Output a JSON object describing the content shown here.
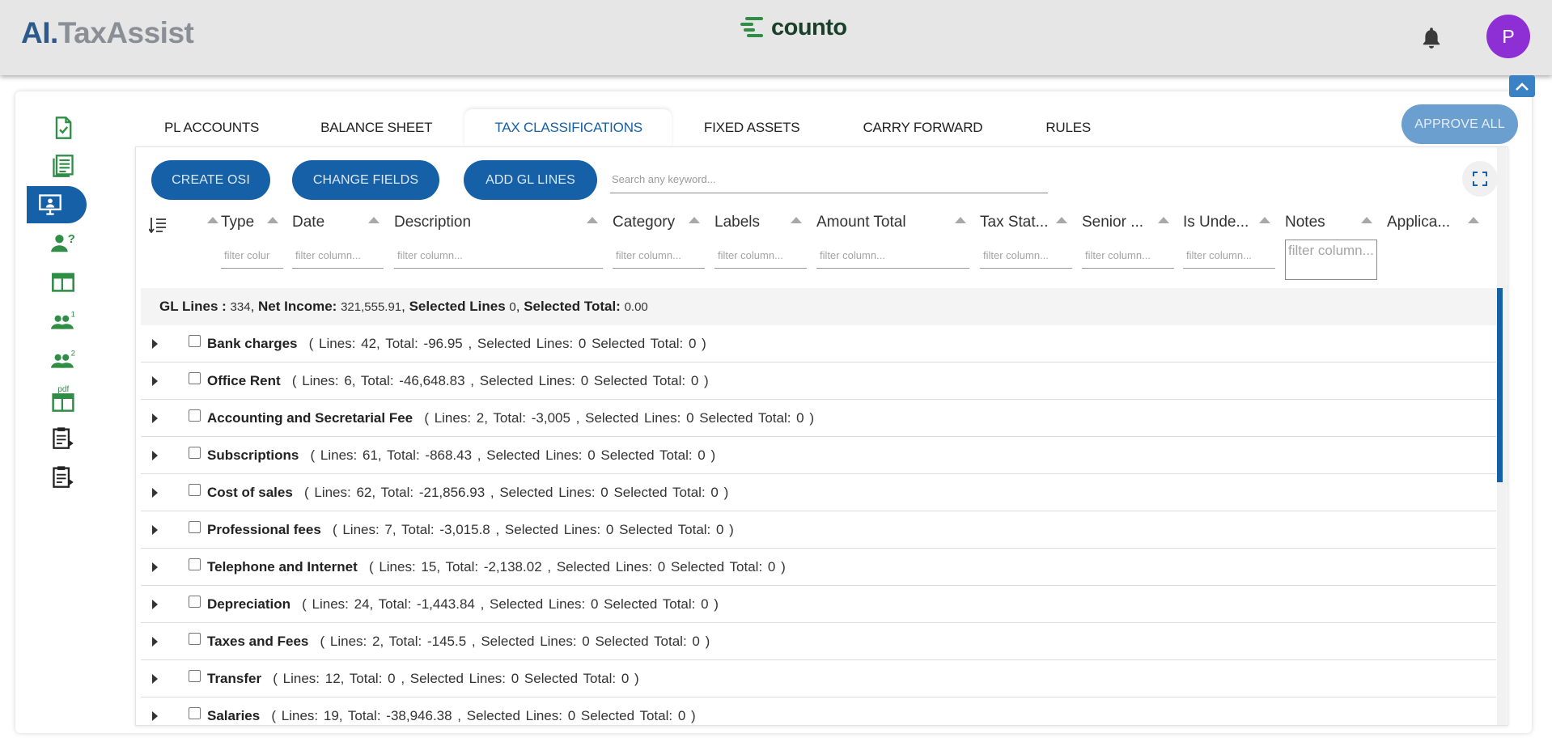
{
  "brand": {
    "part1": "AI.",
    "part2": "TaxAssist"
  },
  "logo_text": "counto",
  "avatar_initial": "P",
  "tabs": [
    {
      "label": "PL ACCOUNTS",
      "active": false
    },
    {
      "label": "BALANCE SHEET",
      "active": false
    },
    {
      "label": "TAX CLASSIFICATIONS",
      "active": true
    },
    {
      "label": "FIXED ASSETS",
      "active": false
    },
    {
      "label": "CARRY FORWARD",
      "active": false
    },
    {
      "label": "RULES",
      "active": false
    }
  ],
  "approve_all": "APPROVE ALL",
  "toolbar": {
    "create_osi": "CREATE OSI",
    "change_fields": "CHANGE FIELDS",
    "add_gl_lines": "ADD GL LINES",
    "search_placeholder": "Search any keyword..."
  },
  "columns": [
    {
      "label": "Type",
      "filter_placeholder": "filter colur"
    },
    {
      "label": "Date",
      "filter_placeholder": "filter column..."
    },
    {
      "label": "Description",
      "filter_placeholder": "filter column..."
    },
    {
      "label": "Category",
      "filter_placeholder": "filter column..."
    },
    {
      "label": "Labels",
      "filter_placeholder": "filter column..."
    },
    {
      "label": "Amount Total",
      "filter_placeholder": "filter column..."
    },
    {
      "label": "Tax Stat...",
      "filter_placeholder": "filter column..."
    },
    {
      "label": "Senior ...",
      "filter_placeholder": "filter column..."
    },
    {
      "label": "Is Unde...",
      "filter_placeholder": "filter column..."
    },
    {
      "label": "Notes",
      "filter_placeholder": "filter column..."
    },
    {
      "label": "Applica..."
    }
  ],
  "summary": {
    "gl_lines_label": "GL Lines :",
    "gl_lines": "334",
    "net_income_label": "Net Income:",
    "net_income": "321,555.91",
    "selected_lines_label": "Selected Lines",
    "selected_lines": "0",
    "selected_total_label": "Selected Total:",
    "selected_total": "0.00"
  },
  "groups": [
    {
      "name": "Bank charges",
      "details": "(   Lines: 42,    Total:    -96.95 ,    Selected Lines: 0    Selected Total: 0 )"
    },
    {
      "name": "Office Rent",
      "details": "(   Lines: 6,    Total:    -46,648.83 ,    Selected Lines: 0    Selected Total: 0 )"
    },
    {
      "name": "Accounting and Secretarial Fee",
      "details": "(   Lines: 2,    Total:    -3,005 ,    Selected Lines: 0    Selected Total: 0 )"
    },
    {
      "name": "Subscriptions",
      "details": "(   Lines: 61,    Total:    -868.43 ,    Selected Lines: 0    Selected Total: 0 )"
    },
    {
      "name": "Cost of sales",
      "details": "(   Lines: 62,    Total:    -21,856.93 ,    Selected Lines: 0    Selected Total: 0 )"
    },
    {
      "name": "Professional fees",
      "details": "(   Lines: 7,    Total:    -3,015.8 ,    Selected Lines: 0    Selected Total: 0 )"
    },
    {
      "name": "Telephone and Internet",
      "details": "(   Lines: 15,    Total:    -2,138.02 ,    Selected Lines: 0    Selected Total: 0 )"
    },
    {
      "name": "Depreciation",
      "details": "(   Lines: 24,    Total:    -1,443.84 ,    Selected Lines: 0    Selected Total: 0 )"
    },
    {
      "name": "Taxes and Fees",
      "details": "(   Lines: 2,    Total:    -145.5 ,    Selected Lines: 0    Selected Total: 0 )"
    },
    {
      "name": "Transfer",
      "details": "(   Lines: 12,    Total:    0 ,    Selected Lines: 0    Selected Total: 0 )"
    },
    {
      "name": "Salaries",
      "details": "(   Lines: 19,    Total:    -38,946.38 ,    Selected Lines: 0    Selected Total: 0 )"
    }
  ],
  "sidebar": {
    "icons": [
      "document-check-icon",
      "list-document-icon",
      "monitor-user-icon",
      "user-question-icon",
      "table-window-icon",
      "users-one-icon",
      "users-two-icon",
      "pdf-table-icon",
      "clipboard-arrow-icon",
      "clipboard-arrow-icon-2"
    ],
    "active_index": 2,
    "badges": {
      "users_one": "1",
      "users_two": "2",
      "pdf": "pdf"
    }
  },
  "colors": {
    "primary": "#1560a6",
    "icon_green": "#2f8d45",
    "avatar": "#8e2fd6",
    "brand_blue": "#2d5a8c",
    "brand_gray": "#8a8f96"
  }
}
